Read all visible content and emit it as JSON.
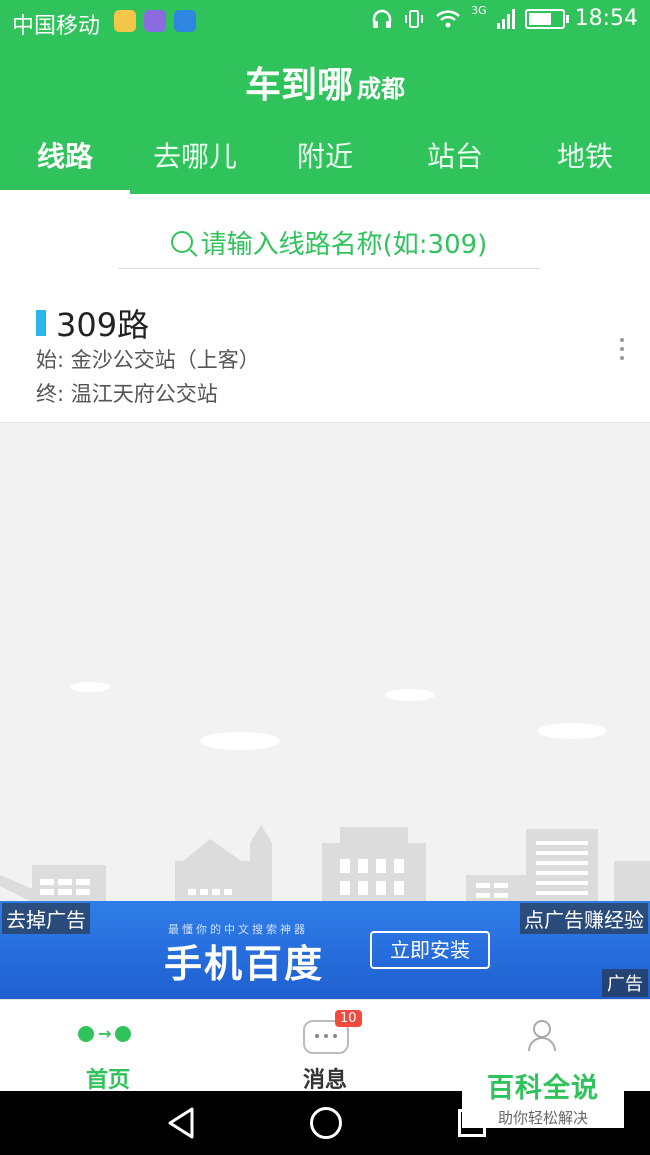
{
  "status_bar": {
    "carrier": "中国移动",
    "network": "3G",
    "time": "18:54",
    "icons": [
      "app-notification-icon-1",
      "app-notification-icon-2",
      "app-notification-icon-3",
      "headphones-icon",
      "vibrate-icon",
      "wifi-icon",
      "signal-icon",
      "battery-icon"
    ]
  },
  "header": {
    "title": "车到哪",
    "city": "成都",
    "background_color": "#30c35b"
  },
  "tabs": [
    {
      "label": "线路",
      "active": true
    },
    {
      "label": "去哪儿",
      "active": false
    },
    {
      "label": "附近",
      "active": false
    },
    {
      "label": "站台",
      "active": false
    },
    {
      "label": "地铁",
      "active": false
    }
  ],
  "search": {
    "placeholder": "请输入线路名称(如:309)"
  },
  "route": {
    "name": "309路",
    "start": "始: 金沙公交站（上客）",
    "end": "终: 温江天府公交站",
    "accent_color": "#2cb5e8"
  },
  "ad": {
    "remove_label": "去掉广告",
    "earn_label": "点广告赚经验",
    "tag": "广告",
    "subtitle": "最懂你的中文搜索神器",
    "title": "手机百度",
    "button": "立即安装"
  },
  "bottom_nav": {
    "home_label": "首页",
    "messages_label": "消息",
    "messages_badge": "10"
  },
  "watermark": {
    "title": "百科全说",
    "subtitle": "助你轻松解决"
  }
}
